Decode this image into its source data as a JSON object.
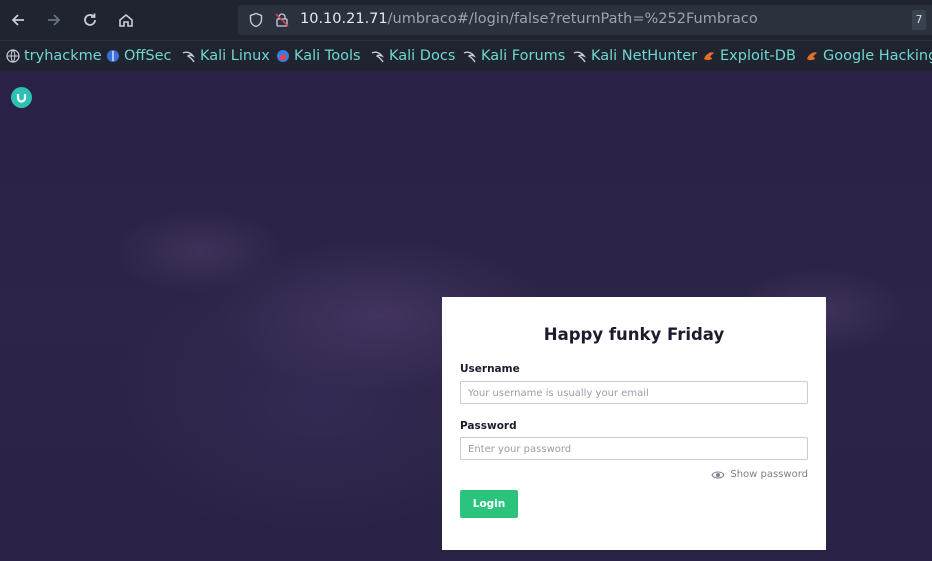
{
  "browser": {
    "url_host": "10.10.21.71",
    "url_path": "/umbraco#/login/false?returnPath=%252Fumbraco",
    "badge": "7"
  },
  "bookmarks": [
    {
      "label": "tryhackme",
      "icon": "globe-icon"
    },
    {
      "label": "OffSec",
      "icon": "offsec-icon"
    },
    {
      "label": "Kali Linux",
      "icon": "kali-dragon-icon"
    },
    {
      "label": "Kali Tools",
      "icon": "kali-tools-icon"
    },
    {
      "label": "Kali Docs",
      "icon": "kali-dragon-icon"
    },
    {
      "label": "Kali Forums",
      "icon": "kali-dragon-icon"
    },
    {
      "label": "Kali NetHunter",
      "icon": "kali-dragon-icon"
    },
    {
      "label": "Exploit-DB",
      "icon": "exploit-db-icon"
    },
    {
      "label": "Google Hacking",
      "icon": "exploit-db-icon"
    }
  ],
  "login": {
    "title": "Happy funky Friday",
    "username_label": "Username",
    "username_placeholder": "Your username is usually your email",
    "password_label": "Password",
    "password_placeholder": "Enter your password",
    "show_password": "Show password",
    "login_button": "Login"
  },
  "colors": {
    "accent": "#2bc37d",
    "logo": "#2bc2b5",
    "bookmark_text": "#6fd7cf"
  }
}
